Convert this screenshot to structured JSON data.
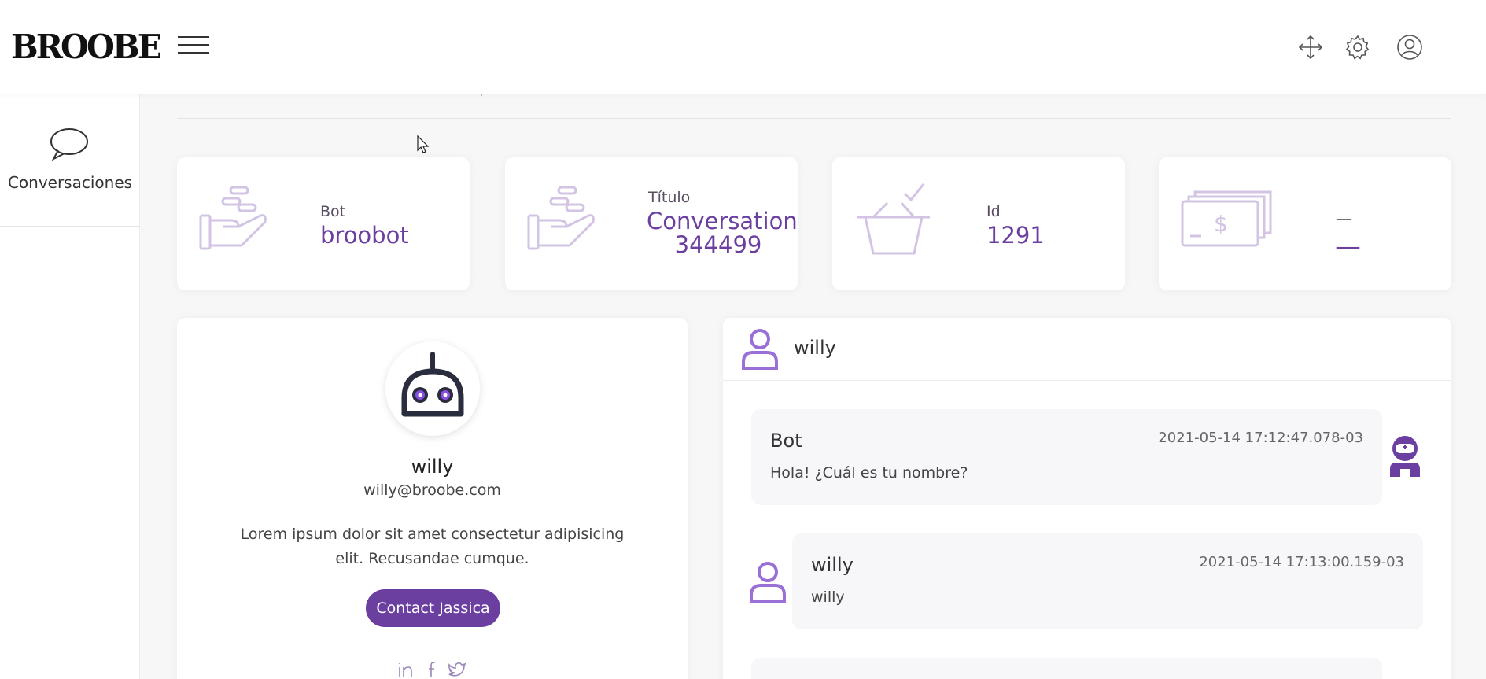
{
  "app": {
    "logo_text": "BROOBE"
  },
  "topbar": {
    "icons": [
      "move-icon",
      "gear-icon",
      "user-circle-icon"
    ]
  },
  "sidebar": {
    "items": [
      {
        "label": "Conversaciones",
        "icon": "chat-bubble-icon"
      }
    ]
  },
  "stats": [
    {
      "label": "Bot",
      "value": "broobot",
      "icon": "hand-coins-icon"
    },
    {
      "label": "Título",
      "value": "Conversation 344499",
      "icon": "hand-coins-icon"
    },
    {
      "label": "Id",
      "value": "1291",
      "icon": "basket-check-icon"
    },
    {
      "label": "__",
      "value": "__",
      "icon": "banknotes-icon"
    }
  ],
  "profile": {
    "name": "willy",
    "email": "willy@broobe.com",
    "description": "Lorem ipsum dolor sit amet consectetur adipisicing elit. Recusandae cumque.",
    "contact_label": "Contact Jassica",
    "socials": [
      "linkedin-icon",
      "facebook-icon",
      "twitter-icon"
    ]
  },
  "chat": {
    "header_name": "willy",
    "messages": [
      {
        "sender": "Bot",
        "time": "2021-05-14 17:12:47.078-03",
        "text": "Hola! ¿Cuál es tu nombre?"
      },
      {
        "sender": "willy",
        "time": "2021-05-14 17:13:00.159-03",
        "text": "willy"
      }
    ]
  },
  "colors": {
    "accent": "#6a3fa0",
    "icon_light": "#d3c4e4",
    "background": "#f7f7f8"
  }
}
